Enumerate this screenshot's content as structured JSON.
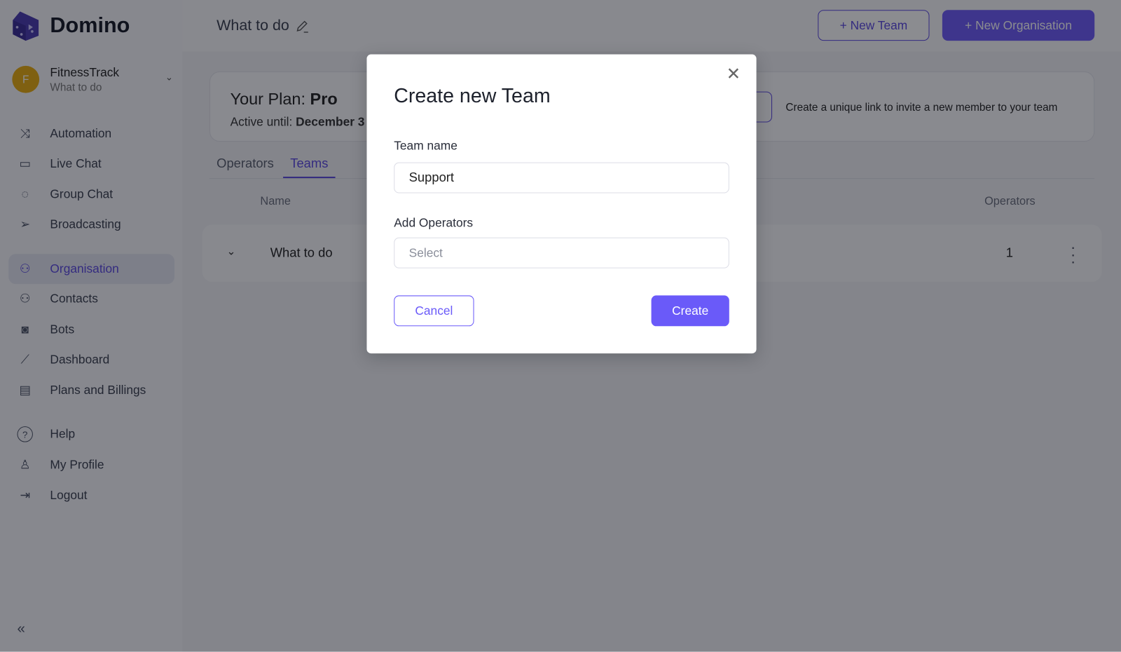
{
  "app": {
    "name": "Domino"
  },
  "org": {
    "avatar_letter": "F",
    "name": "FitnessTrack",
    "subtitle": "What to do"
  },
  "sidebar": {
    "items": [
      {
        "label": "Automation",
        "icon": "shuffle-icon"
      },
      {
        "label": "Live Chat",
        "icon": "chat-icon"
      },
      {
        "label": "Group Chat",
        "icon": "group-chat-icon"
      },
      {
        "label": "Broadcasting",
        "icon": "send-icon"
      },
      {
        "label": "Organisation",
        "icon": "organisation-icon",
        "active": true
      },
      {
        "label": "Contacts",
        "icon": "contacts-icon"
      },
      {
        "label": "Bots",
        "icon": "bot-icon"
      },
      {
        "label": "Dashboard",
        "icon": "chart-icon"
      },
      {
        "label": "Plans and Billings",
        "icon": "billing-icon"
      },
      {
        "label": "Help",
        "icon": "help-icon"
      },
      {
        "label": "My Profile",
        "icon": "user-icon"
      },
      {
        "label": "Logout",
        "icon": "logout-icon"
      }
    ],
    "collapse_icon": "«"
  },
  "header": {
    "title": "What to do",
    "new_team": "+ New Team",
    "new_org": "+ New Organisation"
  },
  "plan": {
    "label": "Your Plan: ",
    "name": "Pro",
    "active_label": "Active until: ",
    "active_date": "December 3",
    "invite_text": "Create a unique link to invite a new member to your team"
  },
  "tabs": [
    "Operators",
    "Teams"
  ],
  "table": {
    "headers": {
      "name": "Name",
      "operators": "Operators"
    },
    "rows": [
      {
        "name": "What to do",
        "operators": "1"
      }
    ]
  },
  "modal": {
    "title": "Create new Team",
    "team_name_label": "Team name",
    "team_name_value": "Support",
    "operators_label": "Add Operators",
    "operators_placeholder": "Select",
    "cancel": "Cancel",
    "create": "Create"
  },
  "colors": {
    "accent": "#6a5af9",
    "avatar": "#e8ac10"
  }
}
